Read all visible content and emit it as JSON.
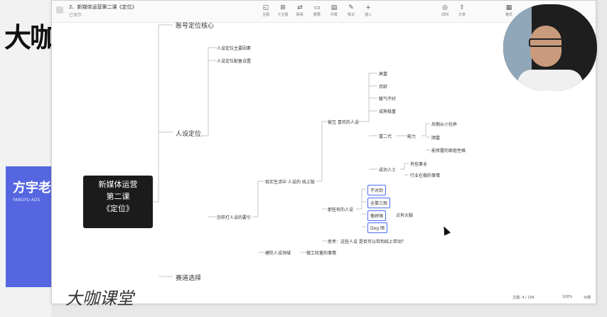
{
  "background": {
    "logo": "大咖",
    "blue_title": "方宇老",
    "blue_sub": "FANGYU ADS"
  },
  "titlebar": {
    "doc_title": "2、新媒体运营第二课《定位》",
    "doc_sub": "已保存",
    "tools": [
      {
        "icon": "theme-icon",
        "glyph": "◱",
        "label": "主题"
      },
      {
        "icon": "subtopic-icon",
        "glyph": "⊞",
        "label": "子主题"
      },
      {
        "icon": "link-icon",
        "glyph": "⇄",
        "label": "联系"
      },
      {
        "icon": "frame-icon",
        "glyph": "▭",
        "label": "概要"
      },
      {
        "icon": "outline-icon",
        "glyph": "▤",
        "label": "外框"
      },
      {
        "icon": "note-icon",
        "glyph": "✎",
        "label": "笔记"
      },
      {
        "icon": "insert-icon",
        "glyph": "+",
        "label": "插入"
      }
    ],
    "right_tools": [
      {
        "icon": "zen-icon",
        "glyph": "◎",
        "label": "ZEN"
      },
      {
        "icon": "share-icon",
        "glyph": "⇪",
        "label": "分享"
      },
      {
        "icon": "format-icon",
        "glyph": "▦",
        "label": "格式"
      }
    ]
  },
  "mindmap": {
    "root": [
      "新媒体运营",
      "第二课",
      "《定位》"
    ],
    "branches": {
      "account": "账号定位核心",
      "persona": "人设定位",
      "track": "赛道选择"
    },
    "persona_sub": {
      "factors": "人设定位主要因素",
      "tips": "人设定位配备设置",
      "goodman": "怎样打人设的要引"
    },
    "goodman_sub": {
      "stage": "现实生活中 人设的 线上版",
      "other": "建防人设领域",
      "other_note": "做工较量的事情"
    },
    "stage_sub": {
      "loved": "被互 喜欢的人设",
      "lable": "那些有的人设",
      "q": "思考：这些人设 是否可以带到线上带动？"
    },
    "loved_items": [
      "高富",
      "月龄",
      "暖气不好",
      "成熟稳重",
      "富二代",
      "成功人士"
    ],
    "rich_sub": {
      "label": "能力",
      "items": [
        "后期从小包养",
        "顺富",
        "能挥霍的家庭性格"
      ]
    },
    "success_sub": [
      "有些事业",
      "行业在做的事情"
    ],
    "box_items": [
      "不对劲",
      "全靠三观",
      "傲娇嗨",
      "Dog 顺"
    ],
    "box_note": "点有头脑"
  },
  "statusbar": {
    "topics": "主题: 4 / 156",
    "zoom": "100%",
    "view": "大纲"
  },
  "watermark": "大咖课堂"
}
